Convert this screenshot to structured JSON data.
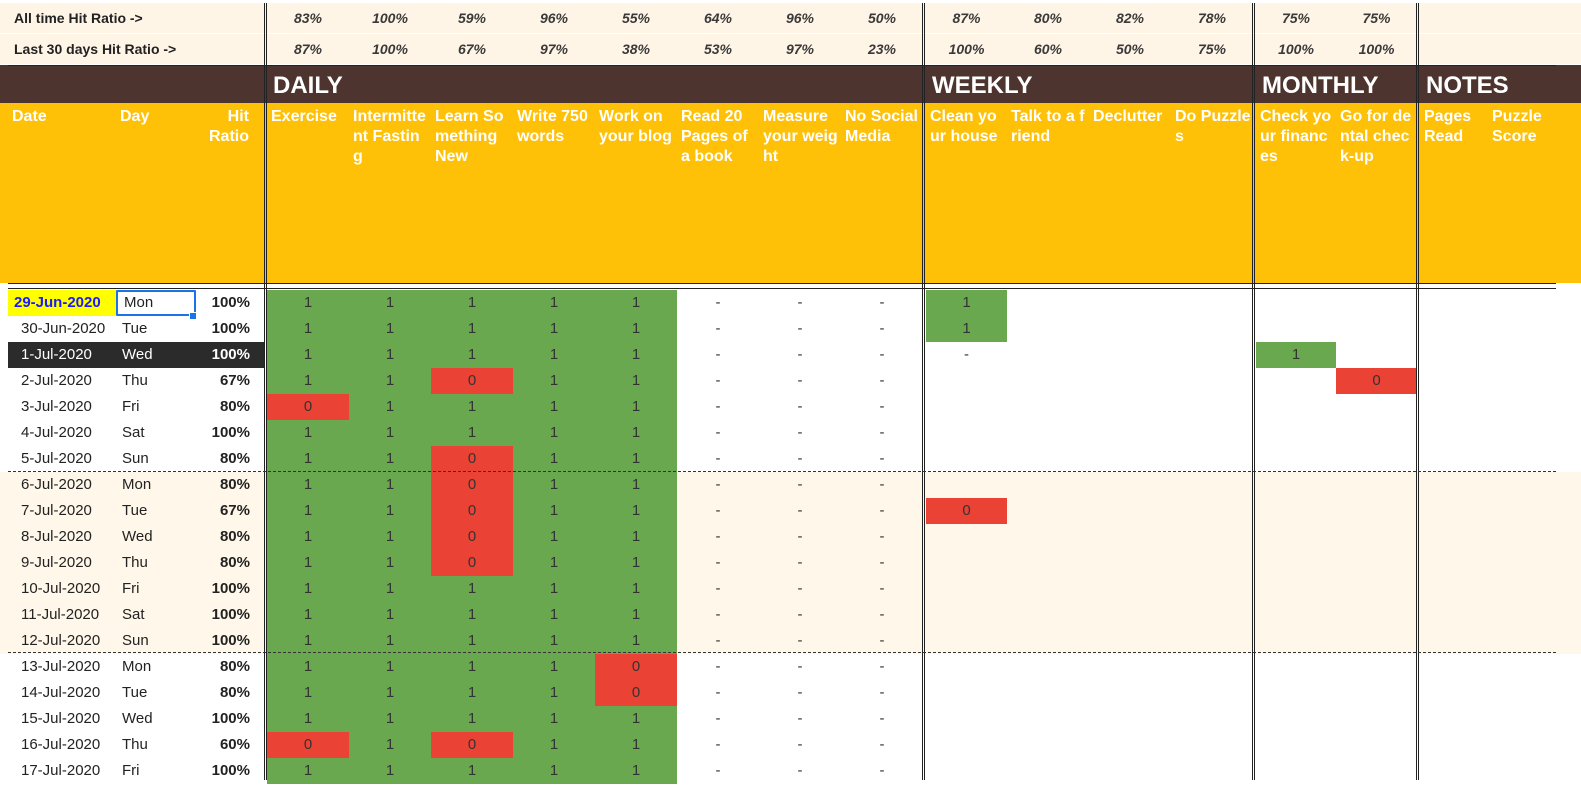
{
  "stats": {
    "all_time": {
      "label": "All time Hit Ratio ->",
      "values": [
        "83%",
        "100%",
        "59%",
        "96%",
        "55%",
        "64%",
        "96%",
        "50%",
        "87%",
        "80%",
        "82%",
        "78%",
        "75%",
        "75%"
      ]
    },
    "last_30": {
      "label": "Last 30 days Hit Ratio ->",
      "values": [
        "87%",
        "100%",
        "67%",
        "97%",
        "38%",
        "53%",
        "97%",
        "23%",
        "100%",
        "60%",
        "50%",
        "75%",
        "100%",
        "100%"
      ]
    }
  },
  "sections": [
    "DAILY",
    "WEEKLY",
    "MONTHLY",
    "NOTES"
  ],
  "headers": [
    "Date",
    "Day",
    "Hit Ratio",
    "Exercise",
    "Intermittent Fasting",
    "Learn Something New",
    "Write 750 words",
    "Work on your blog",
    "Read 20 Pages of a book",
    "Measure your weight",
    "No Social Media",
    "Clean your house",
    "Talk to a friend",
    "Declutter",
    "Do Puzzles",
    "Check your finances",
    "Go for dental check-up",
    "Pages Read",
    "Puzzle Score"
  ],
  "rows": [
    {
      "date": "29-Jun-2020",
      "day": "Mon",
      "ratio": "100%",
      "marks": [
        "1",
        "1",
        "1",
        "1",
        "1",
        "-",
        "-",
        "-",
        "1",
        "",
        "",
        "",
        "",
        "",
        "",
        ""
      ]
    },
    {
      "date": "30-Jun-2020",
      "day": "Tue",
      "ratio": "100%",
      "marks": [
        "1",
        "1",
        "1",
        "1",
        "1",
        "-",
        "-",
        "-",
        "1",
        "",
        "",
        "",
        "",
        "",
        "",
        ""
      ]
    },
    {
      "date": "1-Jul-2020",
      "day": "Wed",
      "ratio": "100%",
      "marks": [
        "1",
        "1",
        "1",
        "1",
        "1",
        "-",
        "-",
        "-",
        "-",
        "",
        "",
        "",
        "1",
        "",
        "",
        ""
      ]
    },
    {
      "date": "2-Jul-2020",
      "day": "Thu",
      "ratio": "67%",
      "marks": [
        "1",
        "1",
        "0",
        "1",
        "1",
        "-",
        "-",
        "-",
        "",
        "",
        "",
        "",
        "",
        "0",
        "",
        ""
      ]
    },
    {
      "date": "3-Jul-2020",
      "day": "Fri",
      "ratio": "80%",
      "marks": [
        "0",
        "1",
        "1",
        "1",
        "1",
        "-",
        "-",
        "-",
        "",
        "",
        "",
        "",
        "",
        "",
        "",
        ""
      ]
    },
    {
      "date": "4-Jul-2020",
      "day": "Sat",
      "ratio": "100%",
      "marks": [
        "1",
        "1",
        "1",
        "1",
        "1",
        "-",
        "-",
        "-",
        "",
        "",
        "",
        "",
        "",
        "",
        "",
        ""
      ]
    },
    {
      "date": "5-Jul-2020",
      "day": "Sun",
      "ratio": "80%",
      "marks": [
        "1",
        "1",
        "0",
        "1",
        "1",
        "-",
        "-",
        "-",
        "",
        "",
        "",
        "",
        "",
        "",
        "",
        ""
      ]
    },
    {
      "date": "6-Jul-2020",
      "day": "Mon",
      "ratio": "80%",
      "marks": [
        "1",
        "1",
        "0",
        "1",
        "1",
        "-",
        "-",
        "-",
        "",
        "",
        "",
        "",
        "",
        "",
        "",
        ""
      ]
    },
    {
      "date": "7-Jul-2020",
      "day": "Tue",
      "ratio": "67%",
      "marks": [
        "1",
        "1",
        "0",
        "1",
        "1",
        "-",
        "-",
        "-",
        "0",
        "",
        "",
        "",
        "",
        "",
        "",
        ""
      ]
    },
    {
      "date": "8-Jul-2020",
      "day": "Wed",
      "ratio": "80%",
      "marks": [
        "1",
        "1",
        "0",
        "1",
        "1",
        "-",
        "-",
        "-",
        "",
        "",
        "",
        "",
        "",
        "",
        "",
        ""
      ]
    },
    {
      "date": "9-Jul-2020",
      "day": "Thu",
      "ratio": "80%",
      "marks": [
        "1",
        "1",
        "0",
        "1",
        "1",
        "-",
        "-",
        "-",
        "",
        "",
        "",
        "",
        "",
        "",
        "",
        ""
      ]
    },
    {
      "date": "10-Jul-2020",
      "day": "Fri",
      "ratio": "100%",
      "marks": [
        "1",
        "1",
        "1",
        "1",
        "1",
        "-",
        "-",
        "-",
        "",
        "",
        "",
        "",
        "",
        "",
        "",
        ""
      ]
    },
    {
      "date": "11-Jul-2020",
      "day": "Sat",
      "ratio": "100%",
      "marks": [
        "1",
        "1",
        "1",
        "1",
        "1",
        "-",
        "-",
        "-",
        "",
        "",
        "",
        "",
        "",
        "",
        "",
        ""
      ]
    },
    {
      "date": "12-Jul-2020",
      "day": "Sun",
      "ratio": "100%",
      "marks": [
        "1",
        "1",
        "1",
        "1",
        "1",
        "-",
        "-",
        "-",
        "",
        "",
        "",
        "",
        "",
        "",
        "",
        ""
      ]
    },
    {
      "date": "13-Jul-2020",
      "day": "Mon",
      "ratio": "80%",
      "marks": [
        "1",
        "1",
        "1",
        "1",
        "0",
        "-",
        "-",
        "-",
        "",
        "",
        "",
        "",
        "",
        "",
        "",
        ""
      ]
    },
    {
      "date": "14-Jul-2020",
      "day": "Tue",
      "ratio": "80%",
      "marks": [
        "1",
        "1",
        "1",
        "1",
        "0",
        "-",
        "-",
        "-",
        "",
        "",
        "",
        "",
        "",
        "",
        "",
        ""
      ]
    },
    {
      "date": "15-Jul-2020",
      "day": "Wed",
      "ratio": "100%",
      "marks": [
        "1",
        "1",
        "1",
        "1",
        "1",
        "-",
        "-",
        "-",
        "",
        "",
        "",
        "",
        "",
        "",
        "",
        ""
      ]
    },
    {
      "date": "16-Jul-2020",
      "day": "Thu",
      "ratio": "60%",
      "marks": [
        "0",
        "1",
        "0",
        "1",
        "1",
        "-",
        "-",
        "-",
        "",
        "",
        "",
        "",
        "",
        "",
        "",
        ""
      ]
    },
    {
      "date": "17-Jul-2020",
      "day": "Fri",
      "ratio": "100%",
      "marks": [
        "1",
        "1",
        "1",
        "1",
        "1",
        "-",
        "-",
        "-",
        "",
        "",
        "",
        "",
        "",
        "",
        "",
        ""
      ]
    }
  ],
  "colors": {
    "done": "#6aa84f",
    "missed": "#ea4335",
    "header": "#ffc107",
    "band": "#4e342e",
    "active_date": "#ffff00"
  }
}
